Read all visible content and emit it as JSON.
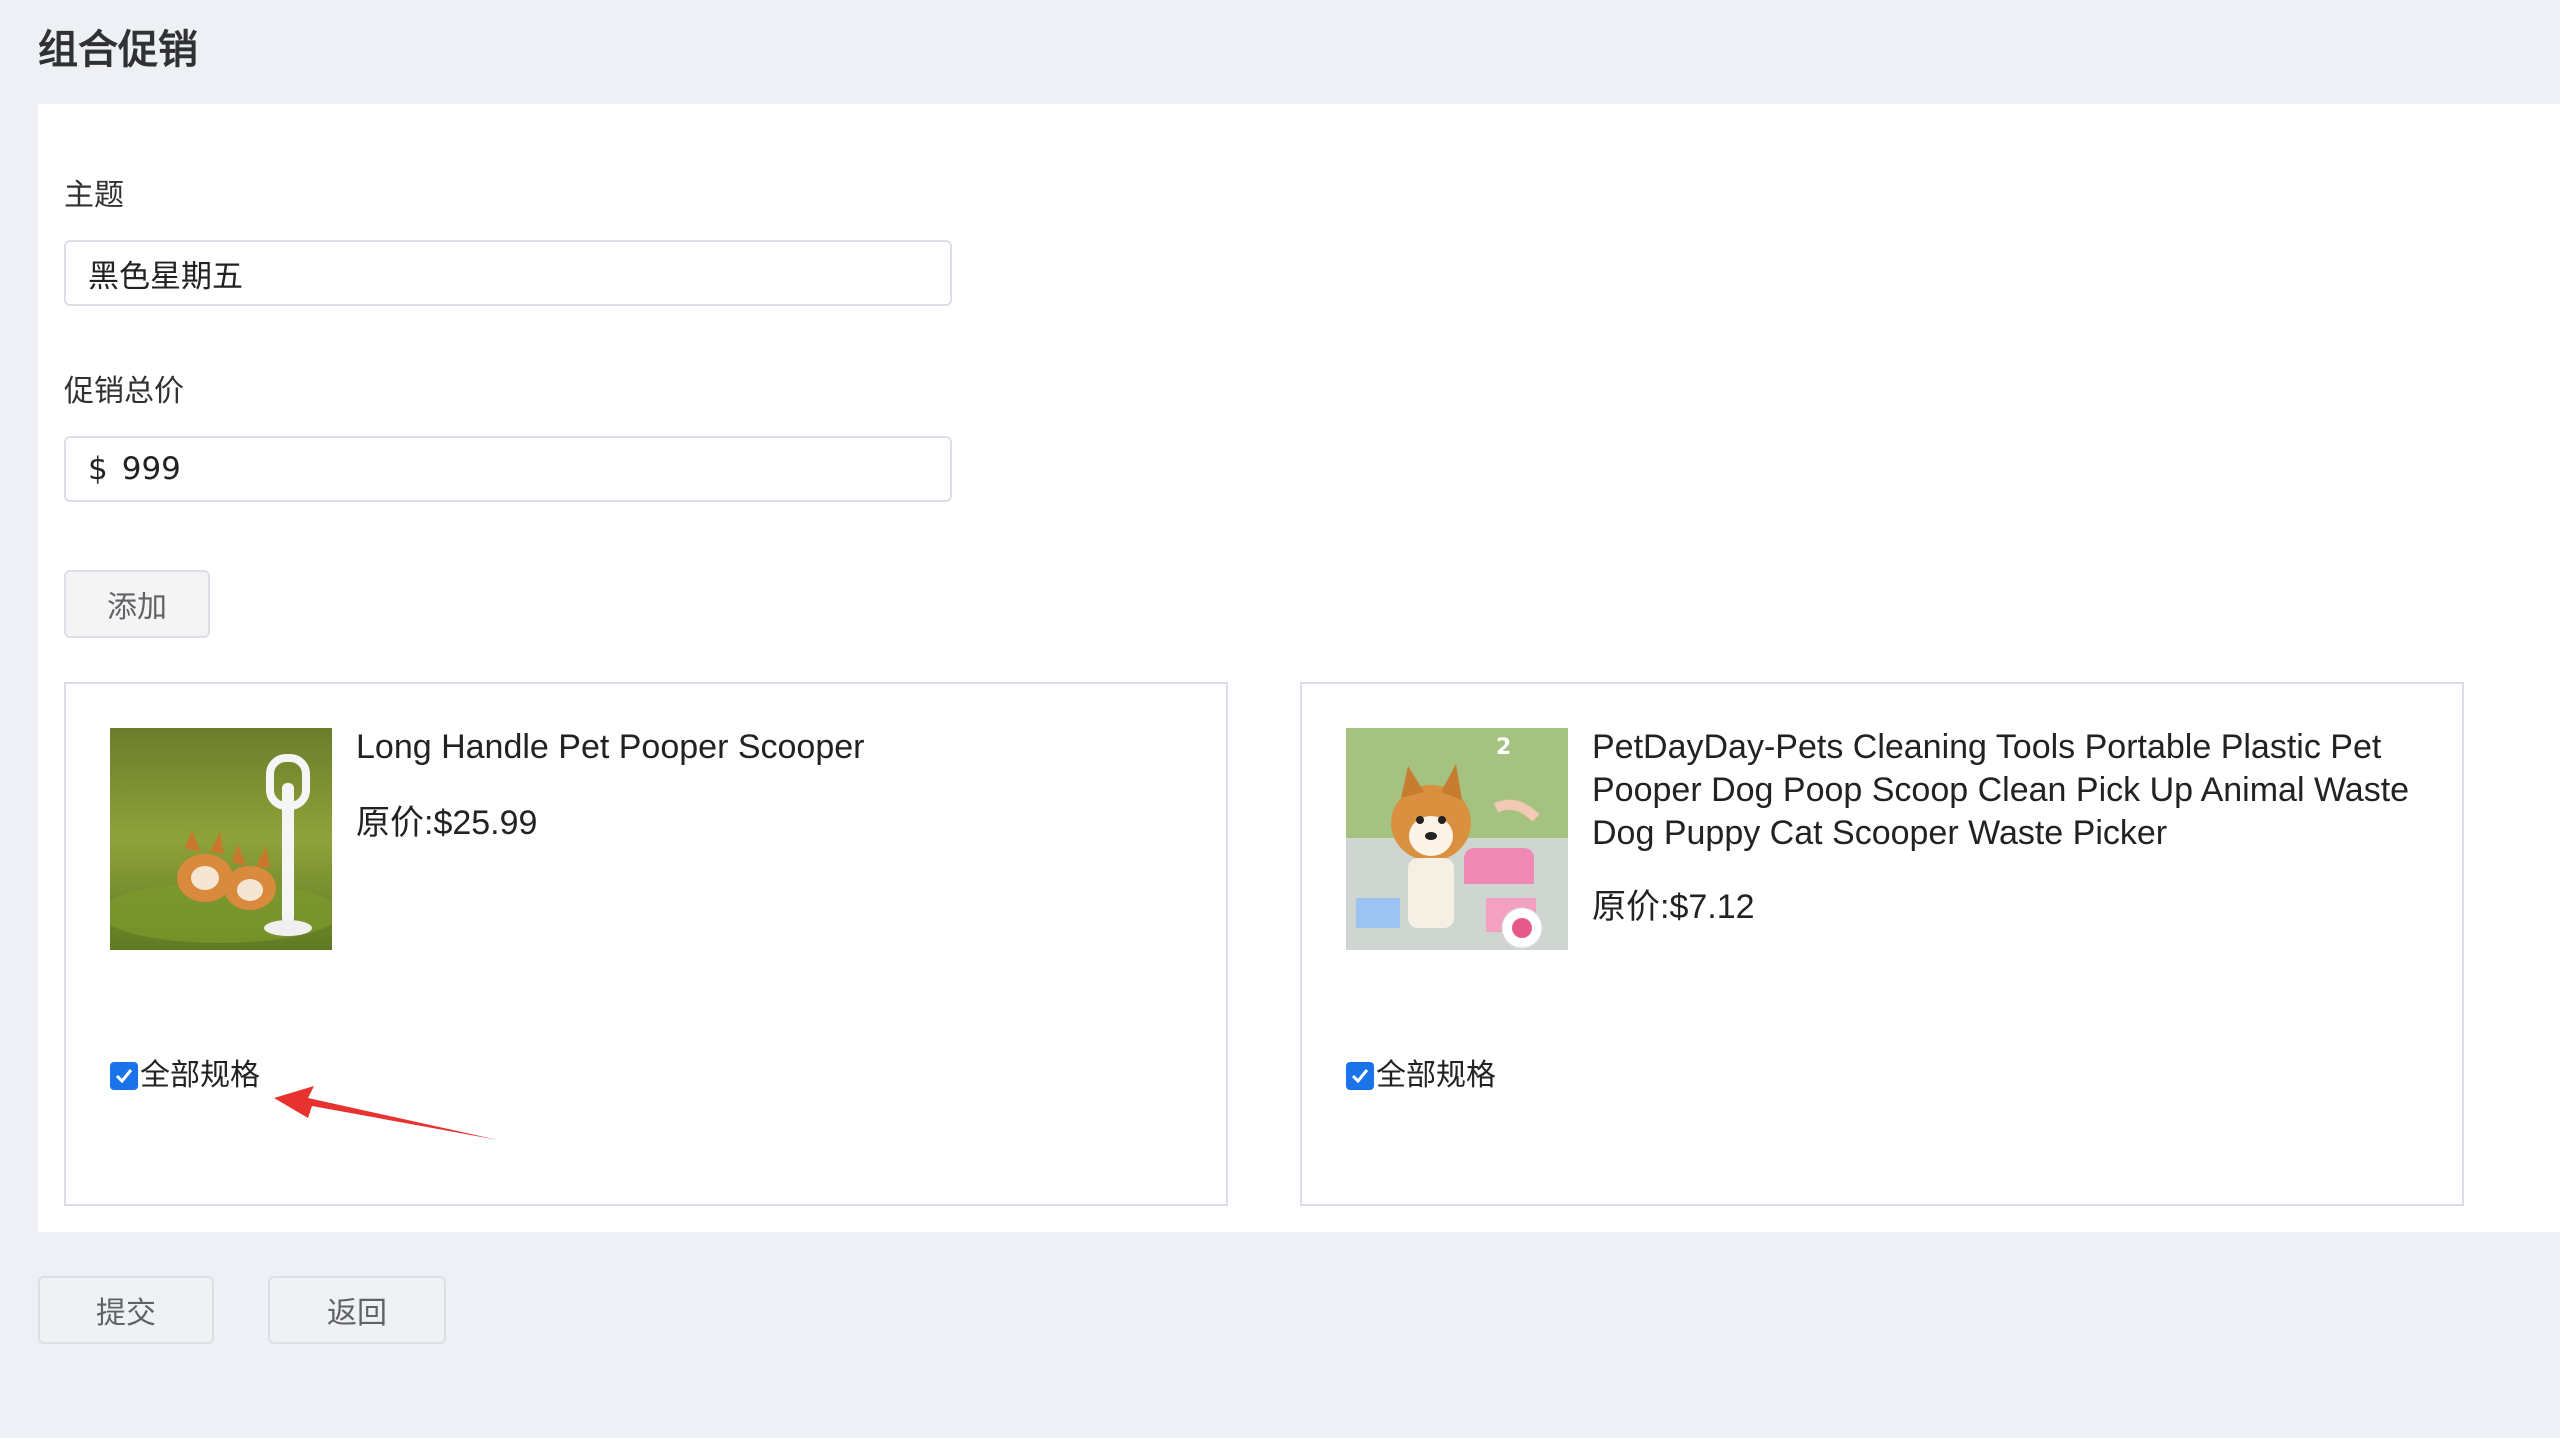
{
  "page": {
    "title": "组合促销"
  },
  "form": {
    "topic_label": "主题",
    "topic_value": "黑色星期五",
    "price_label": "促销总价",
    "price_prefix": "$",
    "price_value": "999",
    "add_button": "添加"
  },
  "products": [
    {
      "name": "Long Handle Pet Pooper Scooper",
      "price": "原价:$25.99",
      "spec_label": "全部规格",
      "spec_checked": true,
      "image_icon": "pet-scooper-photo"
    },
    {
      "name": "PetDayDay-Pets Cleaning Tools Portable Plastic Pet Pooper Dog Poop Scoop Clean Pick Up Animal Waste Dog Puppy Cat Scooper Waste Picker",
      "price": "原价:$7.12",
      "spec_label": "全部规格",
      "spec_checked": true,
      "image_icon": "pet-scoop-photo",
      "image_badge": "2"
    }
  ],
  "footer": {
    "submit_button": "提交",
    "back_button": "返回"
  },
  "colors": {
    "page_bg": "#eef0f5",
    "panel_bg": "#ffffff",
    "border": "#dcdfe6",
    "checkbox": "#1a73e8",
    "annotation_arrow": "#e8322f"
  }
}
